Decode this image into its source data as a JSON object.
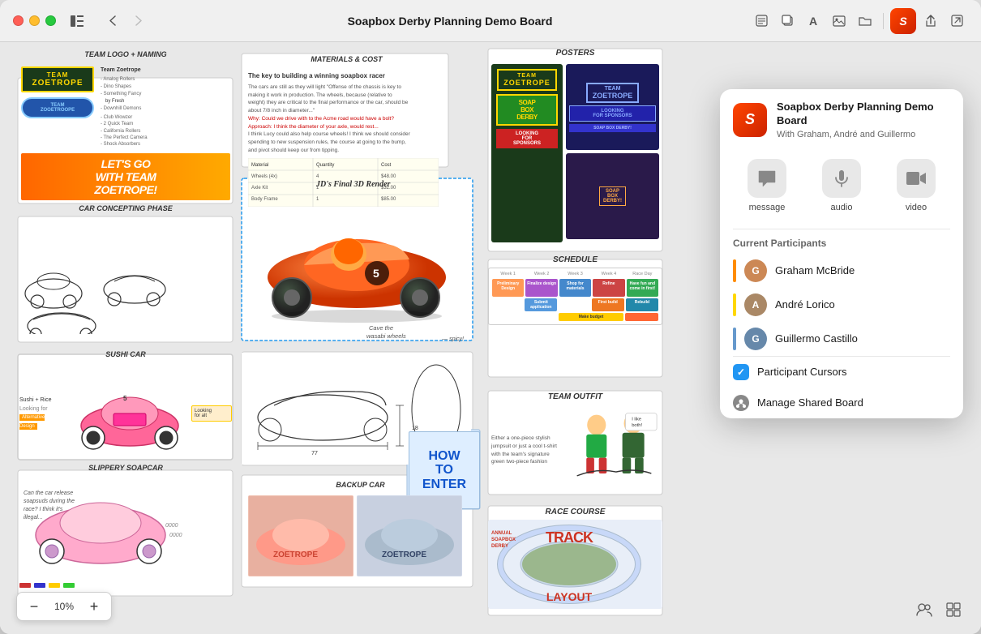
{
  "window": {
    "title": "Soapbox Derby Planning Demo Board",
    "zoom_value": "10%",
    "zoom_label": "10%"
  },
  "titlebar": {
    "back_label": "‹",
    "forward_label": "›",
    "icons": {
      "sidebar": "⬜",
      "copy": "⧉",
      "text": "A",
      "image": "🖼",
      "folder": "📁",
      "share": "↑",
      "expand": "⬜"
    }
  },
  "popup": {
    "app_icon_letter": "S",
    "board_title": "Soapbox Derby Planning Demo Board",
    "subtitle": "With Graham, André and Guillermo",
    "actions": [
      {
        "icon": "💬",
        "label": "message"
      },
      {
        "icon": "📞",
        "label": "audio"
      },
      {
        "icon": "🎥",
        "label": "video"
      }
    ],
    "section_title": "Current Participants",
    "participants": [
      {
        "name": "Graham McBride",
        "color": "#ff8c00",
        "initials": "G"
      },
      {
        "name": "André Lorico",
        "color": "#ffd700",
        "initials": "A"
      },
      {
        "name": "Guillermo Castillo",
        "color": "#6699cc",
        "initials": "G"
      }
    ],
    "options": [
      {
        "type": "check",
        "label": "Participant Cursors"
      },
      {
        "type": "icon",
        "label": "Manage Shared Board"
      }
    ]
  },
  "board": {
    "sections": {
      "team_logo_title": "TEAM LOGO + NAMING",
      "team_name_1": "TEAM\nZOETROPE",
      "team_name_oval": "TEAM\nZOOETROOPE",
      "lets_go": "LET'S GO\nWITH TEAM\nZOETROPE!",
      "car_title": "CAR CONCEPTING PHASE",
      "jd_render": "JD's Final\n3D Render",
      "cave_wheels": "Cave the\nwasabi wheels\n— spicy!",
      "sushi_title": "SUSHI CAR",
      "slippery_title": "SLIPPERY\nSOAPCAR",
      "materials_title": "MATERIALS & COST",
      "backup_title": "BACKUP CAR",
      "posters_title": "POSTERS",
      "soap_box_derby_text": "SOAP\nBOX\nDERBY",
      "looking_for": "LOOKING\nFOR\nSPONSORS",
      "schedule_title": "SCHEDULE",
      "outfit_title": "TEAM OUTFIT",
      "i_like_both": "I like\nboth!",
      "race_title": "RACE COURSE",
      "race_subtitle": "ANNUAL\nSOAPBOX\nDERBY",
      "track_text": "TRACK",
      "layout_text": "LAYOUT",
      "how_to_enter": "HOW\nTO\nENTER"
    }
  },
  "bottombar": {
    "zoom_minus": "−",
    "zoom_value": "10%",
    "zoom_plus": "+"
  }
}
